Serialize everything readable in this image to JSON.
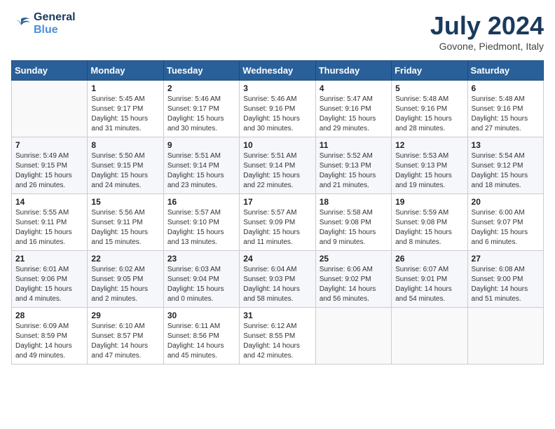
{
  "header": {
    "logo_line1": "General",
    "logo_line2": "Blue",
    "month_title": "July 2024",
    "location": "Govone, Piedmont, Italy"
  },
  "days_of_week": [
    "Sunday",
    "Monday",
    "Tuesday",
    "Wednesday",
    "Thursday",
    "Friday",
    "Saturday"
  ],
  "weeks": [
    [
      {
        "num": "",
        "info": ""
      },
      {
        "num": "1",
        "info": "Sunrise: 5:45 AM\nSunset: 9:17 PM\nDaylight: 15 hours\nand 31 minutes."
      },
      {
        "num": "2",
        "info": "Sunrise: 5:46 AM\nSunset: 9:17 PM\nDaylight: 15 hours\nand 30 minutes."
      },
      {
        "num": "3",
        "info": "Sunrise: 5:46 AM\nSunset: 9:16 PM\nDaylight: 15 hours\nand 30 minutes."
      },
      {
        "num": "4",
        "info": "Sunrise: 5:47 AM\nSunset: 9:16 PM\nDaylight: 15 hours\nand 29 minutes."
      },
      {
        "num": "5",
        "info": "Sunrise: 5:48 AM\nSunset: 9:16 PM\nDaylight: 15 hours\nand 28 minutes."
      },
      {
        "num": "6",
        "info": "Sunrise: 5:48 AM\nSunset: 9:16 PM\nDaylight: 15 hours\nand 27 minutes."
      }
    ],
    [
      {
        "num": "7",
        "info": "Sunrise: 5:49 AM\nSunset: 9:15 PM\nDaylight: 15 hours\nand 26 minutes."
      },
      {
        "num": "8",
        "info": "Sunrise: 5:50 AM\nSunset: 9:15 PM\nDaylight: 15 hours\nand 24 minutes."
      },
      {
        "num": "9",
        "info": "Sunrise: 5:51 AM\nSunset: 9:14 PM\nDaylight: 15 hours\nand 23 minutes."
      },
      {
        "num": "10",
        "info": "Sunrise: 5:51 AM\nSunset: 9:14 PM\nDaylight: 15 hours\nand 22 minutes."
      },
      {
        "num": "11",
        "info": "Sunrise: 5:52 AM\nSunset: 9:13 PM\nDaylight: 15 hours\nand 21 minutes."
      },
      {
        "num": "12",
        "info": "Sunrise: 5:53 AM\nSunset: 9:13 PM\nDaylight: 15 hours\nand 19 minutes."
      },
      {
        "num": "13",
        "info": "Sunrise: 5:54 AM\nSunset: 9:12 PM\nDaylight: 15 hours\nand 18 minutes."
      }
    ],
    [
      {
        "num": "14",
        "info": "Sunrise: 5:55 AM\nSunset: 9:11 PM\nDaylight: 15 hours\nand 16 minutes."
      },
      {
        "num": "15",
        "info": "Sunrise: 5:56 AM\nSunset: 9:11 PM\nDaylight: 15 hours\nand 15 minutes."
      },
      {
        "num": "16",
        "info": "Sunrise: 5:57 AM\nSunset: 9:10 PM\nDaylight: 15 hours\nand 13 minutes."
      },
      {
        "num": "17",
        "info": "Sunrise: 5:57 AM\nSunset: 9:09 PM\nDaylight: 15 hours\nand 11 minutes."
      },
      {
        "num": "18",
        "info": "Sunrise: 5:58 AM\nSunset: 9:08 PM\nDaylight: 15 hours\nand 9 minutes."
      },
      {
        "num": "19",
        "info": "Sunrise: 5:59 AM\nSunset: 9:08 PM\nDaylight: 15 hours\nand 8 minutes."
      },
      {
        "num": "20",
        "info": "Sunrise: 6:00 AM\nSunset: 9:07 PM\nDaylight: 15 hours\nand 6 minutes."
      }
    ],
    [
      {
        "num": "21",
        "info": "Sunrise: 6:01 AM\nSunset: 9:06 PM\nDaylight: 15 hours\nand 4 minutes."
      },
      {
        "num": "22",
        "info": "Sunrise: 6:02 AM\nSunset: 9:05 PM\nDaylight: 15 hours\nand 2 minutes."
      },
      {
        "num": "23",
        "info": "Sunrise: 6:03 AM\nSunset: 9:04 PM\nDaylight: 15 hours\nand 0 minutes."
      },
      {
        "num": "24",
        "info": "Sunrise: 6:04 AM\nSunset: 9:03 PM\nDaylight: 14 hours\nand 58 minutes."
      },
      {
        "num": "25",
        "info": "Sunrise: 6:06 AM\nSunset: 9:02 PM\nDaylight: 14 hours\nand 56 minutes."
      },
      {
        "num": "26",
        "info": "Sunrise: 6:07 AM\nSunset: 9:01 PM\nDaylight: 14 hours\nand 54 minutes."
      },
      {
        "num": "27",
        "info": "Sunrise: 6:08 AM\nSunset: 9:00 PM\nDaylight: 14 hours\nand 51 minutes."
      }
    ],
    [
      {
        "num": "28",
        "info": "Sunrise: 6:09 AM\nSunset: 8:59 PM\nDaylight: 14 hours\nand 49 minutes."
      },
      {
        "num": "29",
        "info": "Sunrise: 6:10 AM\nSunset: 8:57 PM\nDaylight: 14 hours\nand 47 minutes."
      },
      {
        "num": "30",
        "info": "Sunrise: 6:11 AM\nSunset: 8:56 PM\nDaylight: 14 hours\nand 45 minutes."
      },
      {
        "num": "31",
        "info": "Sunrise: 6:12 AM\nSunset: 8:55 PM\nDaylight: 14 hours\nand 42 minutes."
      },
      {
        "num": "",
        "info": ""
      },
      {
        "num": "",
        "info": ""
      },
      {
        "num": "",
        "info": ""
      }
    ]
  ]
}
